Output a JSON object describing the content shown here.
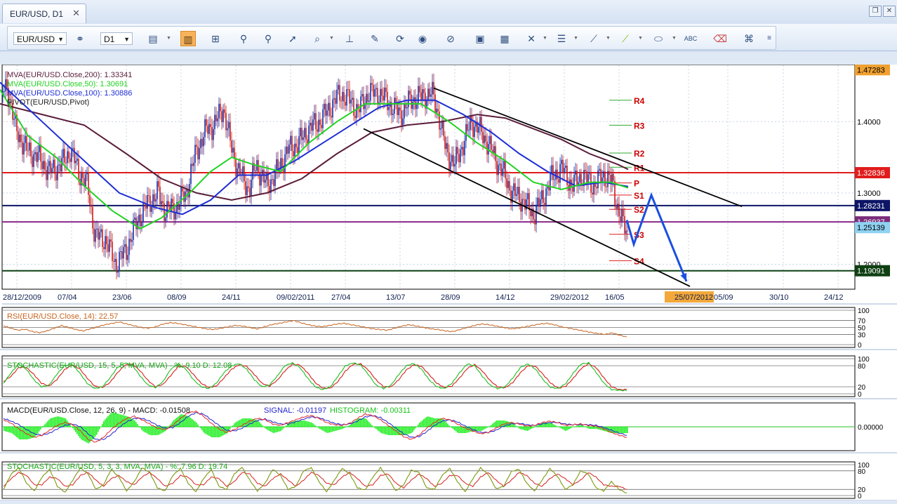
{
  "window": {
    "tab_label": "EUR/USD, D1",
    "tab_close": "✕",
    "restore_glyph": "❐",
    "close_glyph": "✕"
  },
  "toolbar": {
    "symbol": "EUR/USD",
    "timeframe": "D1",
    "icons": [
      "chart-type-icon",
      "ohlc-icon",
      "bar-icon",
      "zoom-in-icon",
      "zoom-out-icon",
      "cursor-icon",
      "zoom-icon",
      "period-icon",
      "edit-icon",
      "refresh-icon",
      "globe-icon",
      "ruler-icon",
      "picture-icon",
      "screenshot-icon",
      "crosshair-icon",
      "lines-icon",
      "pencil-icon",
      "line-icon",
      "ellipse-icon",
      "text-icon",
      "eraser-icon",
      "tree-icon"
    ]
  },
  "colors": {
    "mva200": "#5b1d3a",
    "mva50": "#22d322",
    "mva100": "#1f2ed4",
    "pivot": "#2b2b2b",
    "resistance": "#e01c1c",
    "blue_arrow": "#1a4fe0",
    "rsi": "#c8641e",
    "stoch_k": "#1ebe1e",
    "stoch_d": "#d42020",
    "macd": "#e4282a",
    "signal": "#2424d0",
    "histogram": "#22ee22"
  },
  "chart_data": [
    {
      "type": "candlestick",
      "title": "EUR/USD, D1",
      "legend": [
        {
          "label": "MVA(EUR/USD.Close,200): 1.33341",
          "color": "#5b1d3a"
        },
        {
          "label": "MVA(EUR/USD.Close,50): 1.30691",
          "color": "#22d322"
        },
        {
          "label": "MVA(EUR/USD.Close,100): 1.30886",
          "color": "#1f2ed4"
        },
        {
          "label": "PIVOT(EUR/USD,Pivot)",
          "color": "#222222"
        }
      ],
      "x_ticks": [
        "28/12/2009",
        "07/04",
        "23/06",
        "08/09",
        "24/11",
        "09/02/2011",
        "27/04",
        "13/07",
        "28/09",
        "14/12",
        "29/02/2012",
        "16/05",
        "25/07/2012",
        "05/09",
        "30/10",
        "24/12"
      ],
      "highlighted_x_tick": "25/07/2012",
      "y_ticks": [
        "1.4000",
        "1.3000",
        "1.2000"
      ],
      "ylim": [
        1.165,
        1.48
      ],
      "price_labels": [
        {
          "value": "1.47283",
          "y": 1.4728,
          "bg": "#f0a030",
          "color": "#000000"
        },
        {
          "value": "1.32836",
          "y": 1.3284,
          "bg": "#e01c1c",
          "color": "#ffffff"
        },
        {
          "value": "1.28231",
          "y": 1.2823,
          "bg": "#0c1566",
          "color": "#ffffff"
        },
        {
          "value": "1.26937",
          "y": 1.2594,
          "bg": "#7a2c7a",
          "color": "#ffffff"
        },
        {
          "value": "1.25139",
          "y": 1.2514,
          "bg": "#8fd2f2",
          "color": "#000000"
        },
        {
          "value": "1.19091",
          "y": 1.1909,
          "bg": "#0e3f12",
          "color": "#ffffff"
        }
      ],
      "horizontal_lines": [
        {
          "y": 1.3284,
          "color": "#e01c1c"
        },
        {
          "y": 1.2823,
          "color": "#0c1566"
        },
        {
          "y": 1.2594,
          "color": "#8a2a8a"
        },
        {
          "y": 1.1909,
          "color": "#0e3f12"
        }
      ],
      "pivot_levels": [
        {
          "name": "R4",
          "y": 1.43
        },
        {
          "name": "R3",
          "y": 1.395
        },
        {
          "name": "R2",
          "y": 1.356
        },
        {
          "name": "R1",
          "y": 1.336
        },
        {
          "name": "P",
          "y": 1.314
        },
        {
          "name": "S1",
          "y": 1.297
        },
        {
          "name": "S2",
          "y": 1.277
        },
        {
          "name": "S3",
          "y": 1.242
        },
        {
          "name": "S4",
          "y": 1.205
        }
      ],
      "close_path": [
        [
          0,
          1.435
        ],
        [
          10,
          1.45
        ],
        [
          22,
          1.39
        ],
        [
          38,
          1.36
        ],
        [
          55,
          1.35
        ],
        [
          70,
          1.33
        ],
        [
          88,
          1.34
        ],
        [
          100,
          1.36
        ],
        [
          112,
          1.33
        ],
        [
          125,
          1.31
        ],
        [
          135,
          1.24
        ],
        [
          150,
          1.235
        ],
        [
          165,
          1.2
        ],
        [
          180,
          1.22
        ],
        [
          195,
          1.26
        ],
        [
          210,
          1.285
        ],
        [
          225,
          1.3
        ],
        [
          235,
          1.275
        ],
        [
          250,
          1.28
        ],
        [
          265,
          1.3
        ],
        [
          280,
          1.36
        ],
        [
          295,
          1.39
        ],
        [
          305,
          1.395
        ],
        [
          318,
          1.42
        ],
        [
          328,
          1.37
        ],
        [
          340,
          1.33
        ],
        [
          355,
          1.305
        ],
        [
          365,
          1.34
        ],
        [
          380,
          1.31
        ],
        [
          395,
          1.33
        ],
        [
          410,
          1.36
        ],
        [
          425,
          1.37
        ],
        [
          440,
          1.39
        ],
        [
          455,
          1.4
        ],
        [
          470,
          1.42
        ],
        [
          485,
          1.44
        ],
        [
          498,
          1.43
        ],
        [
          510,
          1.415
        ],
        [
          525,
          1.44
        ],
        [
          540,
          1.44
        ],
        [
          555,
          1.425
        ],
        [
          570,
          1.41
        ],
        [
          585,
          1.43
        ],
        [
          600,
          1.435
        ],
        [
          615,
          1.44
        ],
        [
          625,
          1.41
        ],
        [
          635,
          1.36
        ],
        [
          648,
          1.34
        ],
        [
          660,
          1.37
        ],
        [
          672,
          1.4
        ],
        [
          682,
          1.39
        ],
        [
          695,
          1.37
        ],
        [
          705,
          1.35
        ],
        [
          718,
          1.325
        ],
        [
          730,
          1.3
        ],
        [
          745,
          1.29
        ],
        [
          760,
          1.27
        ],
        [
          772,
          1.29
        ],
        [
          785,
          1.32
        ],
        [
          800,
          1.335
        ],
        [
          815,
          1.31
        ],
        [
          830,
          1.325
        ],
        [
          845,
          1.31
        ],
        [
          860,
          1.325
        ],
        [
          872,
          1.315
        ],
        [
          880,
          1.28
        ],
        [
          888,
          1.255
        ],
        [
          895,
          1.24
        ]
      ],
      "mva50": [
        [
          0,
          1.445
        ],
        [
          40,
          1.38
        ],
        [
          80,
          1.35
        ],
        [
          120,
          1.31
        ],
        [
          160,
          1.275
        ],
        [
          200,
          1.25
        ],
        [
          230,
          1.265
        ],
        [
          270,
          1.3
        ],
        [
          300,
          1.33
        ],
        [
          330,
          1.35
        ],
        [
          360,
          1.34
        ],
        [
          400,
          1.33
        ],
        [
          440,
          1.37
        ],
        [
          480,
          1.4
        ],
        [
          520,
          1.425
        ],
        [
          560,
          1.425
        ],
        [
          600,
          1.425
        ],
        [
          640,
          1.4
        ],
        [
          680,
          1.37
        ],
        [
          720,
          1.345
        ],
        [
          760,
          1.315
        ],
        [
          800,
          1.305
        ],
        [
          840,
          1.315
        ],
        [
          870,
          1.315
        ],
        [
          895,
          1.307
        ]
      ],
      "mva100": [
        [
          0,
          1.455
        ],
        [
          60,
          1.4
        ],
        [
          120,
          1.345
        ],
        [
          170,
          1.3
        ],
        [
          220,
          1.28
        ],
        [
          260,
          1.27
        ],
        [
          300,
          1.29
        ],
        [
          340,
          1.325
        ],
        [
          380,
          1.325
        ],
        [
          420,
          1.345
        ],
        [
          460,
          1.37
        ],
        [
          500,
          1.395
        ],
        [
          540,
          1.42
        ],
        [
          580,
          1.43
        ],
        [
          620,
          1.43
        ],
        [
          660,
          1.41
        ],
        [
          700,
          1.385
        ],
        [
          740,
          1.355
        ],
        [
          780,
          1.33
        ],
        [
          820,
          1.31
        ],
        [
          860,
          1.315
        ],
        [
          895,
          1.309
        ]
      ],
      "mva200": [
        [
          0,
          1.425
        ],
        [
          60,
          1.41
        ],
        [
          120,
          1.395
        ],
        [
          180,
          1.355
        ],
        [
          230,
          1.32
        ],
        [
          280,
          1.3
        ],
        [
          330,
          1.29
        ],
        [
          380,
          1.3
        ],
        [
          430,
          1.32
        ],
        [
          480,
          1.355
        ],
        [
          530,
          1.385
        ],
        [
          580,
          1.395
        ],
        [
          630,
          1.4
        ],
        [
          680,
          1.41
        ],
        [
          720,
          1.405
        ],
        [
          760,
          1.39
        ],
        [
          800,
          1.375
        ],
        [
          840,
          1.355
        ],
        [
          880,
          1.34
        ],
        [
          895,
          1.333
        ]
      ],
      "channel_lines": [
        {
          "x1": 618,
          "y1": 1.447,
          "x2": 1057,
          "y2": 1.281
        },
        {
          "x1": 518,
          "y1": 1.39,
          "x2": 983,
          "y2": 1.169
        }
      ],
      "forecast_path": [
        [
          893,
          1.262
        ],
        [
          903,
          1.228
        ],
        [
          928,
          1.297
        ],
        [
          978,
          1.176
        ]
      ]
    },
    {
      "type": "line",
      "title": "RSI(EUR/USD.Close, 14): 22.57",
      "ylim": [
        0,
        100
      ],
      "y_ticks": [
        "100",
        "70",
        "50",
        "30",
        "0"
      ],
      "values": [
        55,
        48,
        42,
        45,
        38,
        35,
        40,
        48,
        55,
        50,
        44,
        40,
        46,
        52,
        58,
        62,
        66,
        60,
        55,
        50,
        48,
        52,
        60,
        64,
        62,
        58,
        54,
        50,
        46,
        44,
        48,
        52,
        56,
        54,
        50,
        46,
        52,
        58,
        62,
        66,
        70,
        64,
        58,
        54,
        52,
        56,
        60,
        62,
        58,
        54,
        50,
        46,
        44,
        42,
        48,
        54,
        58,
        54,
        50,
        46,
        44,
        40,
        38,
        44,
        50,
        56,
        60,
        58,
        54,
        50,
        46,
        48,
        52,
        56,
        60,
        62,
        58,
        52,
        48,
        44,
        40,
        36,
        32,
        30,
        34,
        28,
        22
      ]
    },
    {
      "type": "line",
      "title": "STOCHASTIC(EUR/USD, 15, 5, 5, MVA, MVA) - %: 9.10  D: 12.08",
      "ylim": [
        0,
        100
      ],
      "y_ticks": [
        "100",
        "80",
        "20",
        "0"
      ],
      "k_values": [
        30,
        60,
        85,
        70,
        40,
        20,
        25,
        55,
        80,
        85,
        60,
        30,
        15,
        20,
        45,
        75,
        88,
        80,
        50,
        25,
        18,
        35,
        70,
        85,
        70,
        40,
        20,
        15,
        30,
        60,
        80,
        86,
        70,
        40,
        20,
        25,
        50,
        80,
        88,
        75,
        45,
        20,
        12,
        20,
        50,
        80,
        88,
        82,
        55,
        25,
        15,
        25,
        55,
        80,
        86,
        70,
        40,
        20,
        15,
        30,
        60,
        85,
        80,
        50,
        25,
        15,
        20,
        45,
        75,
        85,
        70,
        40,
        18,
        15,
        30,
        60,
        85,
        88,
        60,
        30,
        12,
        10,
        9
      ],
      "d_values": [
        35,
        50,
        75,
        75,
        55,
        30,
        22,
        40,
        68,
        82,
        72,
        45,
        22,
        18,
        32,
        60,
        82,
        84,
        65,
        38,
        20,
        27,
        52,
        78,
        78,
        55,
        30,
        18,
        22,
        45,
        70,
        83,
        78,
        55,
        30,
        22,
        38,
        65,
        84,
        82,
        60,
        32,
        16,
        16,
        35,
        65,
        84,
        85,
        68,
        40,
        20,
        20,
        40,
        68,
        83,
        78,
        55,
        30,
        18,
        22,
        45,
        72,
        83,
        65,
        38,
        20,
        17,
        32,
        60,
        80,
        78,
        55,
        30,
        16,
        22,
        45,
        72,
        86,
        74,
        45,
        20,
        12,
        12
      ]
    },
    {
      "type": "line",
      "title": "MACD(EUR/USD.Close, 12, 26, 9) -  MACD: -0.01508",
      "signal_label": "SIGNAL: -0.01197",
      "histogram_label": "HISTOGRAM: -0.00311",
      "y_ticks": [
        "0.00000"
      ],
      "ylim": [
        -0.03,
        0.03
      ],
      "macd_values": [
        0.01,
        0.005,
        -0.003,
        -0.01,
        -0.015,
        -0.012,
        -0.005,
        0.002,
        0.006,
        0.003,
        -0.006,
        -0.018,
        -0.022,
        -0.015,
        -0.004,
        0.005,
        0.012,
        0.015,
        0.01,
        0.004,
        -0.002,
        -0.004,
        0.002,
        0.012,
        0.02,
        0.022,
        0.015,
        0.005,
        -0.003,
        -0.008,
        -0.004,
        0.002,
        0.008,
        0.012,
        0.01,
        0.004,
        0.002,
        0.006,
        0.01,
        0.014,
        0.016,
        0.012,
        0.006,
        0.003,
        0.002,
        0.005,
        0.012,
        0.018,
        0.016,
        0.01,
        0.002,
        -0.006,
        -0.014,
        -0.018,
        -0.012,
        -0.002,
        0.006,
        0.012,
        0.01,
        0.004,
        -0.002,
        -0.006,
        -0.01,
        -0.008,
        -0.002,
        0.004,
        0.006,
        0.004,
        0.001,
        0.002,
        0.006,
        0.008,
        0.006,
        0.002,
        0.003,
        0.004,
        0.002,
        0.001,
        -0.003,
        -0.008,
        -0.012,
        -0.015
      ],
      "signal_values": [
        0.012,
        0.008,
        0.003,
        -0.004,
        -0.01,
        -0.012,
        -0.009,
        -0.003,
        0.002,
        0.004,
        0.0,
        -0.01,
        -0.018,
        -0.018,
        -0.011,
        -0.001,
        0.007,
        0.012,
        0.012,
        0.008,
        0.002,
        -0.002,
        -0.001,
        0.006,
        0.015,
        0.02,
        0.018,
        0.01,
        0.002,
        -0.005,
        -0.006,
        -0.002,
        0.004,
        0.009,
        0.011,
        0.007,
        0.004,
        0.004,
        0.007,
        0.011,
        0.014,
        0.013,
        0.009,
        0.005,
        0.003,
        0.004,
        0.008,
        0.014,
        0.016,
        0.013,
        0.006,
        -0.002,
        -0.01,
        -0.015,
        -0.014,
        -0.007,
        0.002,
        0.008,
        0.01,
        0.007,
        0.001,
        -0.004,
        -0.008,
        -0.008,
        -0.005,
        0.001,
        0.004,
        0.005,
        0.003,
        0.002,
        0.004,
        0.006,
        0.006,
        0.004,
        0.003,
        0.003,
        0.003,
        0.002,
        -0.001,
        -0.005,
        -0.009,
        -0.012
      ]
    },
    {
      "type": "line",
      "title": "STOCHASTIC(EUR/USD, 5, 3, 3, MVA, MVA) - %: 7.96  D: 19.74",
      "ylim": [
        0,
        100
      ],
      "y_ticks": [
        "100",
        "80",
        "20",
        "0"
      ],
      "k_values": [
        20,
        70,
        90,
        40,
        15,
        60,
        85,
        30,
        10,
        50,
        90,
        70,
        20,
        35,
        85,
        60,
        15,
        45,
        90,
        75,
        25,
        15,
        65,
        88,
        40,
        12,
        55,
        85,
        30,
        20,
        70,
        92,
        50,
        15,
        40,
        85,
        65,
        20,
        30,
        80,
        90,
        45,
        12,
        50,
        88,
        70,
        25,
        18,
        60,
        90,
        55,
        15,
        35,
        82,
        75,
        25,
        20,
        65,
        88,
        45,
        12,
        55,
        90,
        68,
        22,
        30,
        78,
        85,
        40,
        15,
        50,
        88,
        62,
        20,
        35,
        80,
        70,
        25,
        15,
        45,
        20,
        8
      ],
      "d_values": [
        30,
        55,
        75,
        65,
        35,
        35,
        60,
        55,
        30,
        35,
        65,
        75,
        50,
        30,
        55,
        65,
        45,
        35,
        60,
        75,
        55,
        30,
        40,
        65,
        60,
        35,
        35,
        60,
        55,
        30,
        45,
        75,
        70,
        40,
        30,
        55,
        70,
        50,
        30,
        50,
        75,
        65,
        40,
        35,
        60,
        75,
        55,
        30,
        35,
        65,
        70,
        40,
        25,
        50,
        70,
        55,
        30,
        40,
        65,
        65,
        40,
        30,
        60,
        75,
        50,
        30,
        50,
        75,
        65,
        40,
        30,
        55,
        70,
        55,
        35,
        50,
        75,
        60,
        35,
        30,
        30,
        20
      ]
    }
  ]
}
